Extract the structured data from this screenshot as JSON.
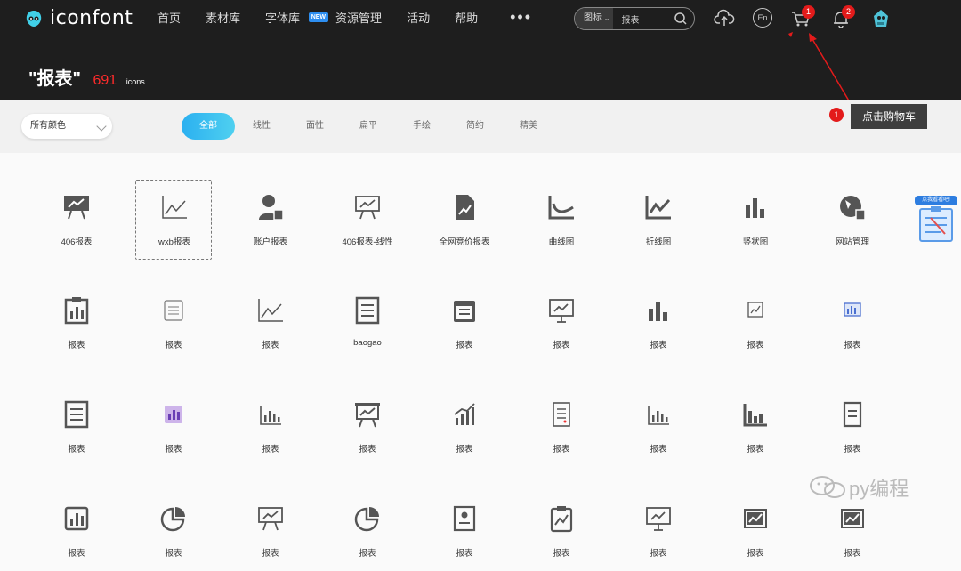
{
  "brand": {
    "name": "iconfont"
  },
  "nav": [
    {
      "label": "首页"
    },
    {
      "label": "素材库"
    },
    {
      "label": "字体库",
      "badge": "NEW"
    },
    {
      "label": "资源管理"
    },
    {
      "label": "活动"
    },
    {
      "label": "帮助"
    }
  ],
  "search": {
    "type": "图标",
    "value": "报表"
  },
  "header_icons": {
    "lang": "En",
    "cart_badge": "1",
    "notif_badge": "2"
  },
  "headline": {
    "query": "\"报表\"",
    "count": "691",
    "unit": "icons"
  },
  "filter": {
    "color_select": "所有颜色",
    "tabs": [
      "全部",
      "线性",
      "面性",
      "扁平",
      "手绘",
      "简约",
      "精美"
    ],
    "active_tab": "全部"
  },
  "annotation": {
    "number": "1",
    "text": "点击购物车"
  },
  "float_card": {
    "label": "点我看看吧!"
  },
  "watermark": {
    "text": "py编程"
  },
  "icons": [
    {
      "label": "406报表",
      "icon": "presentation-chart-icon"
    },
    {
      "label": "wxb报表",
      "icon": "line-chart-icon",
      "selected": true
    },
    {
      "label": "账户报表",
      "icon": "user-report-icon"
    },
    {
      "label": "406报表-线性",
      "icon": "presentation-chart-outline-icon"
    },
    {
      "label": "全网竞价报表",
      "icon": "document-chart-icon"
    },
    {
      "label": "曲线图",
      "icon": "curve-chart-icon"
    },
    {
      "label": "折线图",
      "icon": "zigzag-chart-icon"
    },
    {
      "label": "竖状图",
      "icon": "bar-chart-icon"
    },
    {
      "label": "网站管理",
      "icon": "globe-report-icon"
    },
    {
      "label": "报表",
      "icon": "clipboard-bars-icon"
    },
    {
      "label": "报表",
      "icon": "list-card-icon"
    },
    {
      "label": "报表",
      "icon": "line-chart-icon"
    },
    {
      "label": "baogao",
      "icon": "document-lines-icon"
    },
    {
      "label": "报表",
      "icon": "calendar-list-icon"
    },
    {
      "label": "报表",
      "icon": "monitor-chart-icon"
    },
    {
      "label": "报表",
      "icon": "bar-chart-icon"
    },
    {
      "label": "报表",
      "icon": "small-frame-chart-icon"
    },
    {
      "label": "报表",
      "icon": "blue-board-icon"
    },
    {
      "label": "报表",
      "icon": "document-lines-icon"
    },
    {
      "label": "报表",
      "icon": "purple-bar-chart-icon"
    },
    {
      "label": "报表",
      "icon": "axis-bar-icon"
    },
    {
      "label": "报表",
      "icon": "easel-chart-icon"
    },
    {
      "label": "报表",
      "icon": "growth-chart-icon"
    },
    {
      "label": "报表",
      "icon": "checklist-icon"
    },
    {
      "label": "报表",
      "icon": "axis-bar-icon"
    },
    {
      "label": "报表",
      "icon": "axis-bar-bold-icon"
    },
    {
      "label": "报表",
      "icon": "document-corner-icon"
    },
    {
      "label": "报表",
      "icon": "frame-bar-chart-icon"
    },
    {
      "label": "报表",
      "icon": "pie-chart-icon"
    },
    {
      "label": "报表",
      "icon": "presentation-chart-outline-icon"
    },
    {
      "label": "报表",
      "icon": "pie-chart-icon"
    },
    {
      "label": "报表",
      "icon": "id-card-icon"
    },
    {
      "label": "报表",
      "icon": "clipboard-chart-icon"
    },
    {
      "label": "报表",
      "icon": "monitor-chart-icon"
    },
    {
      "label": "报表",
      "icon": "image-chart-icon"
    },
    {
      "label": "报表",
      "icon": "image-chart-icon"
    }
  ]
}
